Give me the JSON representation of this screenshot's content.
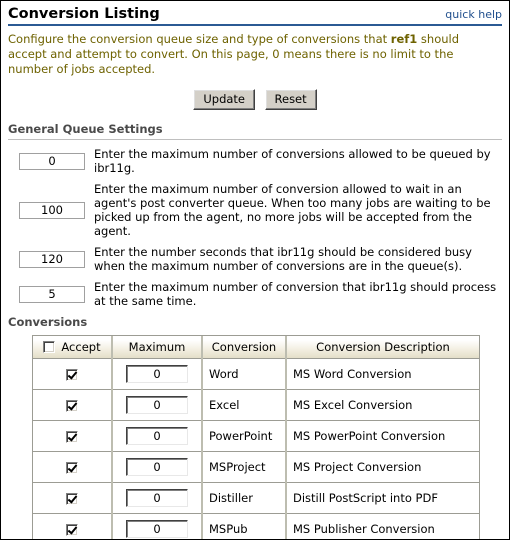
{
  "header": {
    "title": "Conversion Listing",
    "quick_help": "quick help",
    "rule_color": "#2B5A94"
  },
  "intro": {
    "before_bold": "Configure the conversion queue size and type of conversions that ",
    "bold": "ref1",
    "after_bold": " should accept and attempt to convert. On this page, 0 means there is no limit to the number of jobs accepted.",
    "text_color": "#6E6200"
  },
  "buttons": {
    "update": "Update",
    "reset": "Reset"
  },
  "general_queue": {
    "section_title": "General Queue Settings",
    "rows": [
      {
        "value": "0",
        "label": "Enter the maximum number of conversions allowed to be queued by ibr11g."
      },
      {
        "value": "100",
        "label": "Enter the maximum number of conversion allowed to wait in an agent's post converter queue. When too many jobs are waiting to be picked up from the agent, no more jobs will be accepted from the agent."
      },
      {
        "value": "120",
        "label": "Enter the number seconds that ibr11g should be considered busy when the maximum number of conversions are in the queue(s)."
      },
      {
        "value": "5",
        "label": "Enter the maximum number of conversion that ibr11g should process at the same time."
      }
    ]
  },
  "conversions": {
    "section_title": "Conversions",
    "columns": [
      "Accept",
      "Maximum",
      "Conversion",
      "Conversion Description"
    ],
    "header_select_all_checked": false,
    "rows": [
      {
        "accept": true,
        "maximum": "0",
        "conversion": "Word",
        "description": "MS Word Conversion"
      },
      {
        "accept": true,
        "maximum": "0",
        "conversion": "Excel",
        "description": "MS Excel Conversion"
      },
      {
        "accept": true,
        "maximum": "0",
        "conversion": "PowerPoint",
        "description": "MS PowerPoint Conversion"
      },
      {
        "accept": true,
        "maximum": "0",
        "conversion": "MSProject",
        "description": "MS Project Conversion"
      },
      {
        "accept": true,
        "maximum": "0",
        "conversion": "Distiller",
        "description": "Distill PostScript into PDF"
      },
      {
        "accept": true,
        "maximum": "0",
        "conversion": "MSPub",
        "description": "MS Publisher Conversion"
      }
    ]
  }
}
